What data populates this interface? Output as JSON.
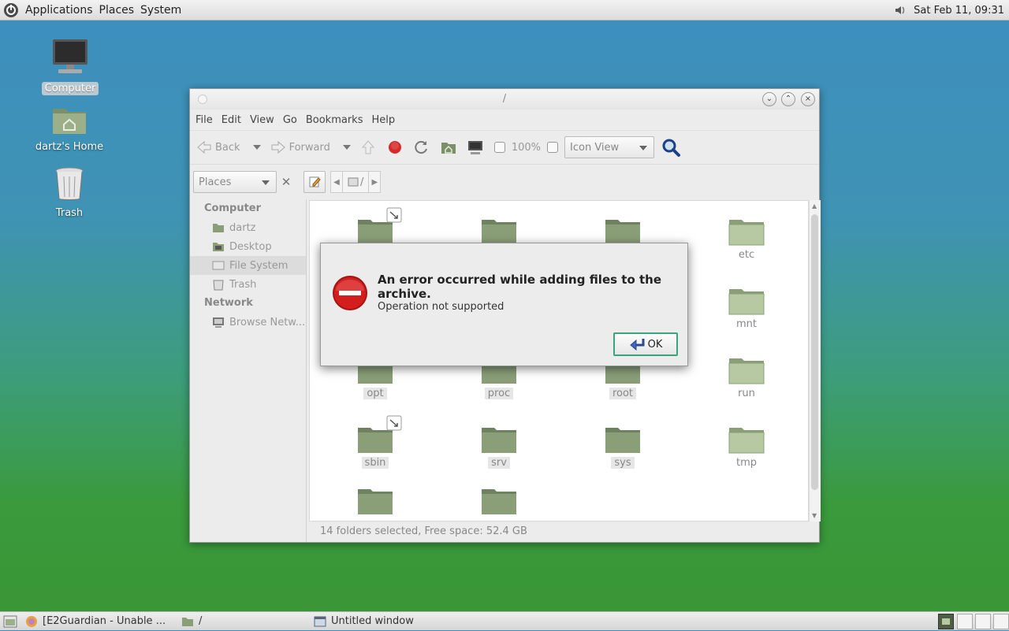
{
  "top_panel": {
    "menus": [
      "Applications",
      "Places",
      "System"
    ],
    "clock": "Sat Feb 11, 09:31"
  },
  "desktop": {
    "icons": [
      {
        "label": "Computer",
        "icon": "computer-icon"
      },
      {
        "label": "dartz's Home",
        "icon": "home-folder-icon"
      },
      {
        "label": "Trash",
        "icon": "trash-icon"
      }
    ]
  },
  "window": {
    "title": "/",
    "menus": [
      "File",
      "Edit",
      "View",
      "Go",
      "Bookmarks",
      "Help"
    ],
    "toolbar": {
      "back": "Back",
      "forward": "Forward",
      "zoom": "100%",
      "view_mode": "Icon View"
    },
    "location": {
      "places_combo": "Places",
      "path_crumb": "/"
    },
    "sidebar": {
      "sections": [
        {
          "heading": "Computer",
          "items": [
            "dartz",
            "Desktop",
            "File System",
            "Trash"
          ]
        },
        {
          "heading": "Network",
          "items": [
            "Browse Netw..."
          ]
        }
      ]
    },
    "folders": [
      "etc",
      "mnt",
      "opt",
      "proc",
      "root",
      "run",
      "sbin",
      "srv",
      "sys",
      "tmp"
    ],
    "status": "14 folders selected, Free space: 52.4 GB"
  },
  "dialog": {
    "heading": "An error occurred while adding files to the archive.",
    "message": "Operation not supported",
    "ok": "OK"
  },
  "taskbar": {
    "tasks": [
      "[E2Guardian - Unable ...",
      "/",
      "Untitled window"
    ]
  },
  "colors": {
    "desktop_top": "#3d8fbf",
    "desktop_bottom": "#3a9535",
    "folder_green": "#8a9f78",
    "error_red": "#d41e1e",
    "ok_border": "#3aa47a"
  }
}
